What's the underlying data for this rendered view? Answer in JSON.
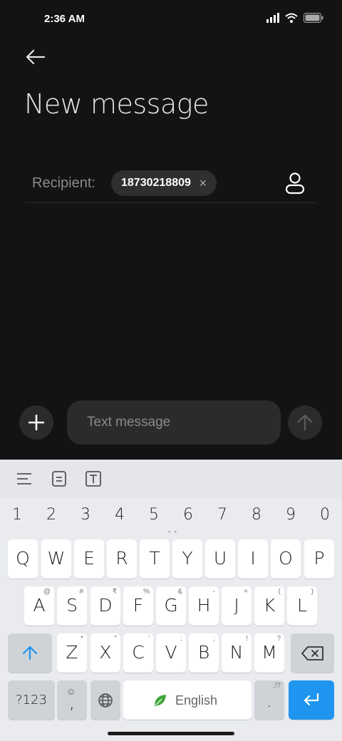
{
  "status_bar": {
    "time": "2:36 AM"
  },
  "header": {
    "title": "New message"
  },
  "recipient": {
    "label": "Recipient:",
    "chip_number": "18730218809",
    "chip_remove": "×"
  },
  "composer": {
    "placeholder": "Text message"
  },
  "keyboard": {
    "numbers": [
      "1",
      "2",
      "3",
      "4",
      "5",
      "6",
      "7",
      "8",
      "9",
      "0"
    ],
    "row1": [
      {
        "k": "Q"
      },
      {
        "k": "W"
      },
      {
        "k": "E"
      },
      {
        "k": "R"
      },
      {
        "k": "T"
      },
      {
        "k": "Y"
      },
      {
        "k": "U"
      },
      {
        "k": "I"
      },
      {
        "k": "O"
      },
      {
        "k": "P"
      }
    ],
    "row2": [
      {
        "k": "A",
        "h": "@"
      },
      {
        "k": "S",
        "h": "#"
      },
      {
        "k": "D",
        "h": "₹"
      },
      {
        "k": "F",
        "h": "%"
      },
      {
        "k": "G",
        "h": "&"
      },
      {
        "k": "H",
        "h": "-"
      },
      {
        "k": "J",
        "h": "+"
      },
      {
        "k": "K",
        "h": "("
      },
      {
        "k": "L",
        "h": ")"
      }
    ],
    "row3": [
      {
        "k": "Z",
        "h": "*"
      },
      {
        "k": "X",
        "h": "\""
      },
      {
        "k": "C",
        "h": "'"
      },
      {
        "k": "V",
        "h": ":"
      },
      {
        "k": "B",
        "h": ";"
      },
      {
        "k": "N",
        "h": "!"
      },
      {
        "k": "M",
        "h": "?"
      }
    ],
    "symbols_label": "?123",
    "comma": ",",
    "space_label": "English",
    "period": ".",
    "period_hint": ",!?"
  },
  "colors": {
    "accent": "#1f95ef",
    "background": "#131313",
    "leaf": "#3fa63b"
  }
}
